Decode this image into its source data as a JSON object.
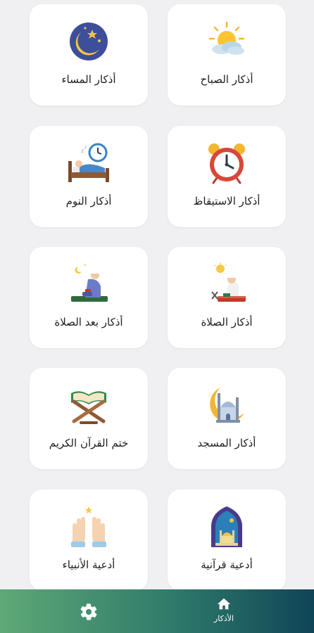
{
  "cards": [
    {
      "label": "أذكار الصباح",
      "icon": "sun-cloud-icon"
    },
    {
      "label": "أذكار المساء",
      "icon": "moon-stars-icon"
    },
    {
      "label": "أذكار الاستيقاظ",
      "icon": "alarm-clock-icon"
    },
    {
      "label": "أذكار النوم",
      "icon": "sleeping-bed-icon"
    },
    {
      "label": "أذكار الصلاة",
      "icon": "praying-man-icon"
    },
    {
      "label": "أذكار بعد الصلاة",
      "icon": "sitting-prayer-icon"
    },
    {
      "label": "أذكار المسجد",
      "icon": "mosque-crescent-icon"
    },
    {
      "label": "ختم القرآن الكريم",
      "icon": "quran-stand-icon"
    },
    {
      "label": "أدعية قرآنية",
      "icon": "mosque-arch-icon"
    },
    {
      "label": "أدعية الأنبياء",
      "icon": "raised-hands-icon"
    }
  ],
  "nav": {
    "home_label": "الأذكار",
    "home_icon": "home-icon",
    "settings_icon": "gear-icon"
  },
  "colors": {
    "background": "#f0f0f2",
    "card": "#ffffff",
    "nav_gradient_start": "#5fa877",
    "nav_gradient_end": "#0f4557"
  }
}
